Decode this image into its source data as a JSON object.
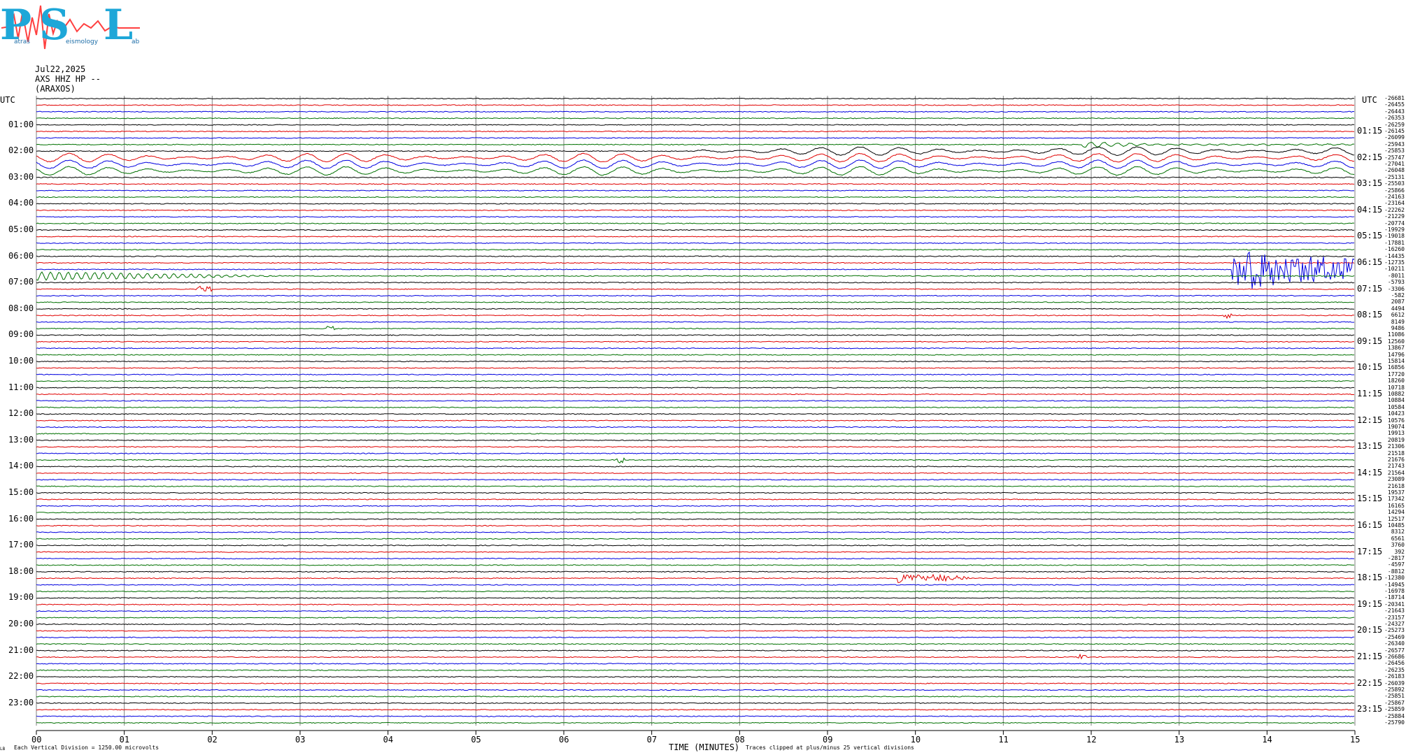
{
  "logo": {
    "text_p": "P",
    "text_s": "S",
    "text_l": "L",
    "small_1": "atras",
    "small_2": "eismology",
    "small_3": "ab"
  },
  "header": {
    "date": "Jul22,2025",
    "channel": "AXS HHZ HP --",
    "station": "(ARAXOS)"
  },
  "utc_left": "UTC",
  "utc_right": "UTC",
  "left_hours": [
    "01:00",
    "02:00",
    "03:00",
    "04:00",
    "05:00",
    "06:00",
    "07:00",
    "08:00",
    "09:00",
    "10:00",
    "11:00",
    "12:00",
    "13:00",
    "14:00",
    "15:00",
    "16:00",
    "17:00",
    "18:00",
    "19:00",
    "20:00",
    "21:00",
    "22:00",
    "23:00"
  ],
  "right_hours": [
    "01:15",
    "02:15",
    "03:15",
    "04:15",
    "05:15",
    "06:15",
    "07:15",
    "08:15",
    "09:15",
    "10:15",
    "11:15",
    "12:15",
    "13:15",
    "14:15",
    "15:15",
    "16:15",
    "17:15",
    "18:15",
    "19:15",
    "20:15",
    "21:15",
    "22:15",
    "23:15"
  ],
  "offsets": [
    "-26681",
    "-26455",
    "-26443",
    "-26353",
    "-26259",
    "-26145",
    "-26099",
    "-25943",
    "-25853",
    "-25747",
    "-27041",
    "-26048",
    "-25131",
    "-25503",
    "-25866",
    "-24163",
    "-23164",
    "-22262",
    "-21229",
    "-20774",
    "-19929",
    "-19018",
    "-17881",
    "-16260",
    "-14435",
    "-12735",
    "-10211",
    "-8011",
    "-5793",
    "-3306",
    "-582",
    "2087",
    "4494",
    "6612",
    "8149",
    "9486",
    "11086",
    "12560",
    "13867",
    "14796",
    "15814",
    "16856",
    "17720",
    "18260",
    "10718",
    "10882",
    "10884",
    "10584",
    "10423",
    "10576",
    "19074",
    "19913",
    "20819",
    "21306",
    "21518",
    "21676",
    "21743",
    "21564",
    "23089",
    "21618",
    "19537",
    "17342",
    "16165",
    "14294",
    "12517",
    "10485",
    "8312",
    "6561",
    "3760",
    "392",
    "-2817",
    "-4597",
    "-8812",
    "-12380",
    "-14945",
    "-16978",
    "-18714",
    "-20341",
    "-21643",
    "-23157",
    "-24327",
    "-25273",
    "-25469",
    "-26340",
    "-26577",
    "-26686",
    "-26456",
    "-26235",
    "-26183",
    "-26039",
    "-25892",
    "-25851",
    "-25867",
    "-25859",
    "-25884",
    "-25790"
  ],
  "x_ticks": [
    "00",
    "01",
    "02",
    "03",
    "04",
    "05",
    "06",
    "07",
    "08",
    "09",
    "10",
    "11",
    "12",
    "13",
    "14",
    "15"
  ],
  "footer": {
    "division": "Each Vertical Division = 1250.00 microvolts",
    "xlabel": "TIME (MINUTES)",
    "clip": "Traces clipped at plus/minus 25 vertical divisions",
    "corner": "LB"
  },
  "colors": {
    "trace_cycle": [
      "#000000",
      "#e00000",
      "#0000e0",
      "#007000"
    ],
    "gridline": "#808080"
  },
  "chart_data": {
    "type": "line",
    "title": "",
    "xlabel": "TIME (MINUTES)",
    "ylabel": "UTC",
    "xlim": [
      0,
      15
    ],
    "trace_minutes": 15,
    "traces_count": 96,
    "events": [
      {
        "trace_time": "01:45",
        "start_min": 11.9,
        "end_min": 15.0,
        "kind": "wiggle"
      },
      {
        "trace_time": "02:00",
        "start_min": 7.5,
        "end_min": 15.0,
        "kind": "long-period"
      },
      {
        "trace_time": "02:15",
        "start_min": 0.0,
        "end_min": 15.0,
        "kind": "long-period"
      },
      {
        "trace_time": "02:30",
        "start_min": 0.0,
        "end_min": 15.0,
        "kind": "long-period"
      },
      {
        "trace_time": "02:45",
        "start_min": 0.0,
        "end_min": 15.0,
        "kind": "long-period"
      },
      {
        "trace_time": "06:30",
        "start_min": 13.6,
        "end_min": 15.0,
        "kind": "earthquake"
      },
      {
        "trace_time": "06:45",
        "start_min": 0.0,
        "end_min": 3.0,
        "kind": "coda"
      },
      {
        "trace_time": "07:15",
        "start_min": 1.8,
        "end_min": 2.0,
        "kind": "spike"
      },
      {
        "trace_time": "08:15",
        "start_min": 13.5,
        "end_min": 13.6,
        "kind": "spike"
      },
      {
        "trace_time": "08:45",
        "start_min": 3.3,
        "end_min": 3.4,
        "kind": "spike"
      },
      {
        "trace_time": "13:45",
        "start_min": 6.6,
        "end_min": 6.7,
        "kind": "spike"
      },
      {
        "trace_time": "18:15",
        "start_min": 9.8,
        "end_min": 10.6,
        "kind": "event"
      },
      {
        "trace_time": "21:15",
        "start_min": 11.85,
        "end_min": 11.95,
        "kind": "spike"
      }
    ]
  }
}
